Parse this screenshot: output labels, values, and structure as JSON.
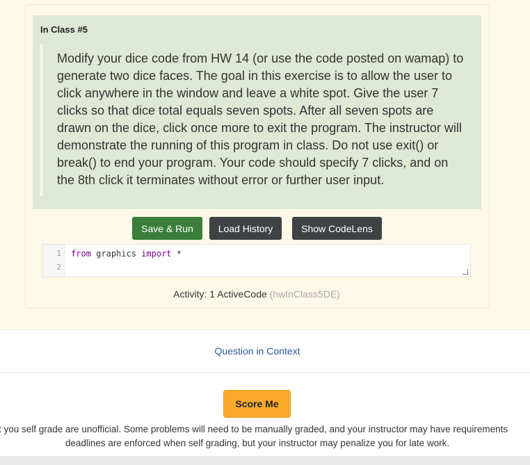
{
  "question": {
    "title": "In Class #5",
    "body": "Modify your dice code from HW 14 (or use the code posted on wamap) to generate two dice faces. The goal in this exercise is to allow the user to click anywhere in the window and leave a white spot. Give the user 7 clicks so that dice total equals seven spots. After all seven spots are drawn on the dice, click once more to exit the program. The instructor will demonstrate the running of this program in class. Do not use exit() or break() to end your program. Your code should specify 7 clicks, and on the 8th click it terminates without error or further user input."
  },
  "buttons": {
    "save_run": "Save & Run",
    "load_history": "Load History",
    "show_codelens": "Show CodeLens"
  },
  "editor": {
    "line1_num": "1",
    "line2_num": "2",
    "kw_from": "from",
    "module": "graphics",
    "kw_import": "import",
    "star": "*"
  },
  "activity": {
    "label": "Activity: 1 ActiveCode",
    "id": "(hwInClass5DE)"
  },
  "context_link": "Question in Context",
  "score_button": "Score Me",
  "note_line1": "t you self grade are unofficial. Some problems will need to be manually graded, and your instructor may have requirements",
  "note_line2": "deadlines are enforced when self grading, but your instructor may penalize you for late work.",
  "colors": {
    "question_bg": "#dfe8d5",
    "save_run": "#3a7e3a",
    "dark_button": "#3f4245",
    "score_button": "#f9a92a",
    "link": "#2a5a9c"
  }
}
